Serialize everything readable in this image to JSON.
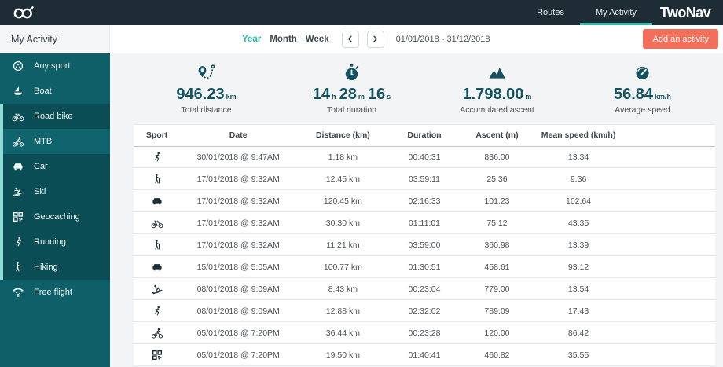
{
  "brand": {
    "name": "TwoNav",
    "logo_icon": "go-infinity"
  },
  "topnav": {
    "items": [
      {
        "label": "Routes"
      },
      {
        "label": "My Activity",
        "active": true
      }
    ]
  },
  "panel": {
    "title": "My Activity"
  },
  "toolbar": {
    "period_tabs": [
      {
        "label": "Year",
        "active": true
      },
      {
        "label": "Month"
      },
      {
        "label": "Week"
      }
    ],
    "prev_icon": "chevron-left",
    "next_icon": "chevron-right",
    "date_range": "01/01/2018 - 31/12/2018",
    "add_button_label": "Add an activity"
  },
  "colors": {
    "accent_teal": "#2cb9a8",
    "sidebar_teal": "#0f5f68",
    "sidebar_selected": "#0b4d54",
    "topbar_dark": "#1d2c35",
    "stat_teal": "#14525f",
    "add_button_coral": "#f2705b"
  },
  "sidebar": {
    "items": [
      {
        "label": "Any sport",
        "icon": "any-sport"
      },
      {
        "label": "Boat",
        "icon": "boat"
      },
      {
        "label": "Road bike",
        "icon": "road-bike",
        "selected": true
      },
      {
        "label": "MTB",
        "icon": "mtb",
        "selected": true,
        "light": true
      },
      {
        "label": "Car",
        "icon": "car",
        "selected": true
      },
      {
        "label": "Ski",
        "icon": "ski",
        "selected": true
      },
      {
        "label": "Geocaching",
        "icon": "geocaching",
        "selected": true
      },
      {
        "label": "Running",
        "icon": "running",
        "selected": true
      },
      {
        "label": "Hiking",
        "icon": "hiking",
        "selected": true
      },
      {
        "label": "Free flight",
        "icon": "free-flight"
      }
    ]
  },
  "stats": {
    "distance": {
      "icon": "route-pin",
      "value": "946.23",
      "unit": "km",
      "label": "Total distance"
    },
    "duration": {
      "icon": "stopwatch",
      "label": "Total duration",
      "parts": {
        "h": "14",
        "h_unit": "h",
        "m": "28",
        "m_unit": "m",
        "s": "16",
        "s_unit": "s"
      }
    },
    "ascent": {
      "icon": "mountains",
      "value": "1.798.00",
      "unit": "m",
      "label": "Accumulated ascent"
    },
    "speed": {
      "icon": "gauge",
      "value": "56.84",
      "unit": "km/h",
      "label": "Average speed"
    }
  },
  "table": {
    "headers": [
      "Sport",
      "Date",
      "Distance (km)",
      "Duration",
      "Ascent (m)",
      "Mean speed (km/h)"
    ],
    "rows": [
      {
        "icon": "running",
        "date": "30/01/2018 @ 9:47AM",
        "distance": "1.18 km",
        "duration": "00:40:31",
        "ascent": "836.00",
        "speed": "13.34"
      },
      {
        "icon": "hiking",
        "date": "17/01/2018 @ 9:32AM",
        "distance": "12.45 km",
        "duration": "03:59:11",
        "ascent": "25.36",
        "speed": "9.36"
      },
      {
        "icon": "car",
        "date": "17/01/2018 @ 9:32AM",
        "distance": "120.45 km",
        "duration": "02:16:33",
        "ascent": "101.23",
        "speed": "102.64"
      },
      {
        "icon": "road-bike",
        "date": "17/01/2018 @ 9:32AM",
        "distance": "30.30 km",
        "duration": "01:11:01",
        "ascent": "75.12",
        "speed": "43.35"
      },
      {
        "icon": "hiking",
        "date": "17/01/2018 @ 9:32AM",
        "distance": "11.21 km",
        "duration": "03:59:00",
        "ascent": "360.98",
        "speed": "13.39"
      },
      {
        "icon": "car",
        "date": "15/01/2018 @ 5:05AM",
        "distance": "100.77 km",
        "duration": "01:30:51",
        "ascent": "458.61",
        "speed": "93.12"
      },
      {
        "icon": "ski",
        "date": "08/01/2018 @ 9:09AM",
        "distance": "8.43 km",
        "duration": "00:23:04",
        "ascent": "779.00",
        "speed": "13.54"
      },
      {
        "icon": "running",
        "date": "08/01/2018 @ 9:09AM",
        "distance": "12.88 km",
        "duration": "02:32:02",
        "ascent": "789.09",
        "speed": "17.43"
      },
      {
        "icon": "mtb",
        "date": "05/01/2018 @ 7:20PM",
        "distance": "36.44 km",
        "duration": "00:23:28",
        "ascent": "120.00",
        "speed": "86.42"
      },
      {
        "icon": "geocaching",
        "date": "05/01/2018 @ 7:20PM",
        "distance": "19.50 km",
        "duration": "01:40:41",
        "ascent": "460.82",
        "speed": "35.55"
      }
    ]
  }
}
